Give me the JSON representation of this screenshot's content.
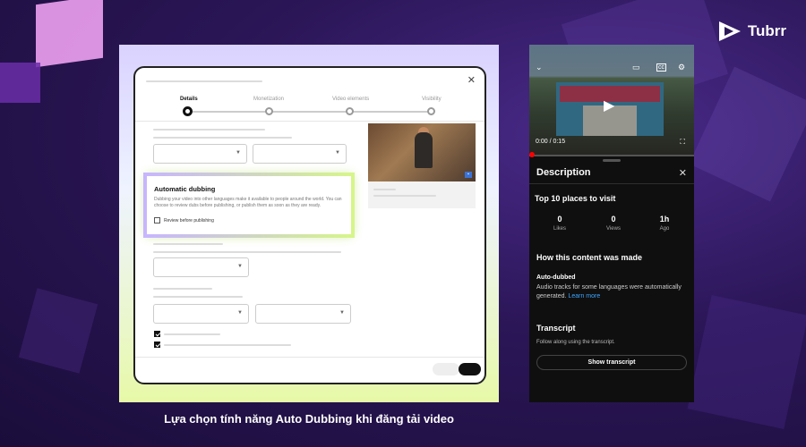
{
  "brand": {
    "name": "Tubrr"
  },
  "caption": "Lựa chọn tính năng Auto Dubbing khi đăng tải video",
  "upload_dialog": {
    "close_icon": "close-icon",
    "steps": [
      {
        "label": "Details",
        "active": true
      },
      {
        "label": "Monetization",
        "active": false
      },
      {
        "label": "Video elements",
        "active": false
      },
      {
        "label": "Visibility",
        "active": false
      }
    ],
    "automatic_dubbing": {
      "title": "Automatic dubbing",
      "description": "Dubbing your video into other languages make it available to people around the world. You can choose to review dubs before publishing, or publish them as soon as they are ready.",
      "checkbox_label": "Review before publishing",
      "checkbox_checked": false
    },
    "bottom_checkboxes": [
      {
        "checked": true
      },
      {
        "checked": true
      }
    ]
  },
  "mobile": {
    "player": {
      "time": "0:00 / 0:15",
      "progress_fraction": 0.0
    },
    "description": {
      "title": "Description",
      "video_title": "Top 10 places to visit",
      "stats": [
        {
          "value": "0",
          "label": "Likes"
        },
        {
          "value": "0",
          "label": "Views"
        },
        {
          "value": "1h",
          "label": "Ago"
        }
      ],
      "how_made_title": "How this content was made",
      "auto_dubbed_title": "Auto-dubbed",
      "auto_dubbed_text": "Audio tracks for some languages were automatically generated.",
      "learn_more": "Learn more",
      "transcript_title": "Transcript",
      "transcript_text": "Follow along using the transcript.",
      "show_transcript": "Show transcript"
    }
  },
  "colors": {
    "background": "#2b1657",
    "accent_link": "#3ea6ff",
    "progress": "#ff0000"
  }
}
